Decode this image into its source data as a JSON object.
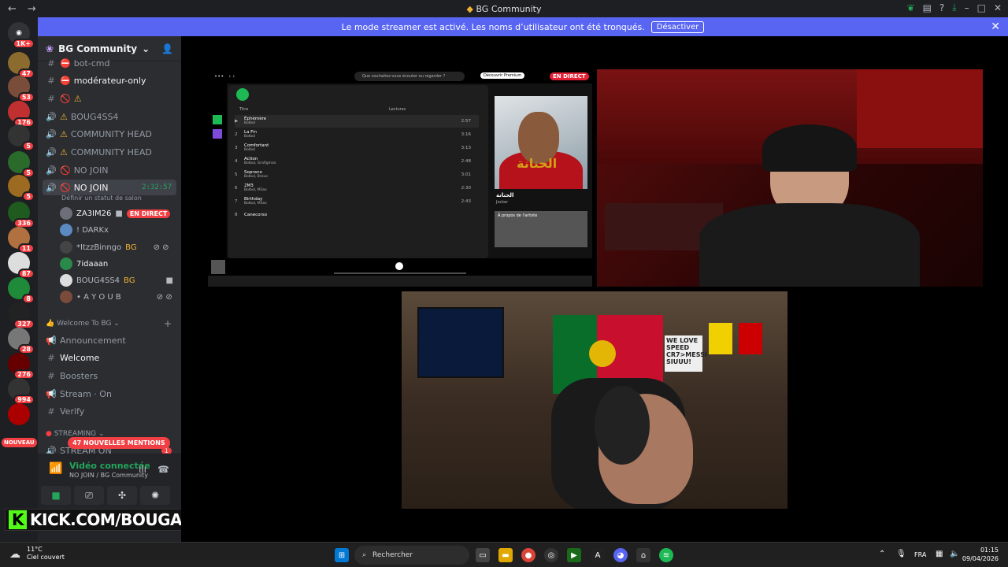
{
  "window": {
    "title": "BG Community",
    "back_glyph": "←",
    "forward_glyph": "→",
    "min": "–",
    "max": "□",
    "close": "✕",
    "help": "?"
  },
  "banner": {
    "text": "Le mode streamer est activé. Les noms d’utilisateur ont été tronqués.",
    "button": "Désactiver",
    "close": "✕"
  },
  "guild_badges": [
    "1K+",
    "47",
    "53",
    "176",
    "5",
    "5",
    "5",
    "336",
    "11",
    "87",
    "8",
    "327",
    "28",
    "276",
    "994",
    "NOUVEAU"
  ],
  "server": {
    "name": "BG Community",
    "chevron": "⌄"
  },
  "channels": [
    {
      "label": "bot-cmd",
      "icon": "#",
      "status": "⛔"
    },
    {
      "label": "modérateur-only",
      "icon": "#",
      "status": "⛔"
    },
    {
      "label": "⚠",
      "icon": "#",
      "status": "🚫"
    },
    {
      "label": "BOUG4SS4",
      "icon": "🔊",
      "status": "⚠"
    },
    {
      "label": "COMMUNITY HEAD",
      "icon": "🔊",
      "status": "⚠"
    },
    {
      "label": "COMMUNITY HEAD",
      "icon": "🔊",
      "status": "⚠"
    },
    {
      "label": "NO JOIN",
      "icon": "🔊",
      "status": "🚫"
    },
    {
      "label": "NO JOIN",
      "icon": "🔊",
      "status": "🚫",
      "timer": "2:32:57"
    }
  ],
  "channel_status_hint": "Définir un statut de salon",
  "voice_users": [
    {
      "name": "ZA3IM26",
      "badge": "EN DIRECT"
    },
    {
      "name": "! DARKx"
    },
    {
      "name": "*ItzzBinngo",
      "tag": "BG"
    },
    {
      "name": "7idaaan"
    },
    {
      "name": "BOUG4SS4",
      "tag": "BG"
    },
    {
      "name": "• A Y O U B"
    }
  ],
  "category1": "Welcome To BG",
  "welcome_channels": [
    {
      "label": "Announcement",
      "icon": "📢"
    },
    {
      "label": "Welcome",
      "icon": "#"
    },
    {
      "label": "Boosters",
      "icon": "#"
    },
    {
      "label": "Stream · On",
      "icon": "📢"
    },
    {
      "label": "Verify",
      "icon": "#"
    }
  ],
  "category2": "STREAMING",
  "stream_channel": "STREAM ON",
  "mentions": "47 NOUVELLES MENTIONS",
  "mention_count": "1",
  "voice_panel": {
    "status": "Vidéo connectée",
    "sub": "NO JOIN / BG Community"
  },
  "kick_overlay": "KICK.COM/BOUGASSAA",
  "spotify": {
    "search_placeholder": "Que souhaitez-vous écouter ou regarder ?",
    "premium": "Découvrir Premium",
    "live": "EN DIRECT",
    "col_title": "Titre",
    "col_plays": "Lectures",
    "tracks": [
      {
        "n": "▶",
        "title": "Éphémère",
        "artist": "Bolbol",
        "dur": "2:57"
      },
      {
        "n": "2",
        "title": "La Fin",
        "artist": "Bolbol",
        "dur": "3:16"
      },
      {
        "n": "3",
        "title": "Comfortant",
        "artist": "Bolbol",
        "dur": "3:13"
      },
      {
        "n": "4",
        "title": "Action",
        "artist": "Bolbol, Grafigman",
        "dur": "2:48"
      },
      {
        "n": "5",
        "title": "Soprano",
        "artist": "Bolbol, Bravo",
        "dur": "3:01"
      },
      {
        "n": "6",
        "title": "2M3",
        "artist": "Bolbol, M3as",
        "dur": "2:30"
      },
      {
        "n": "7",
        "title": "Birthday",
        "artist": "Bolbol, M3as",
        "dur": "2:43"
      },
      {
        "n": "8",
        "title": "Canecorso",
        "artist": "",
        "dur": ""
      }
    ],
    "album_title": "الحنانة",
    "album_sub": "Jocker",
    "artist_about": "À propos de l'artiste"
  },
  "cam2": {
    "sign": "WE LOVE SPEED CR7>MESSI SIUUU!"
  },
  "taskbar": {
    "temp": "11°C",
    "weather": "Ciel couvert",
    "search": "Rechercher",
    "lang": "FRA",
    "time": "01:15",
    "date": "09/04/2026"
  }
}
